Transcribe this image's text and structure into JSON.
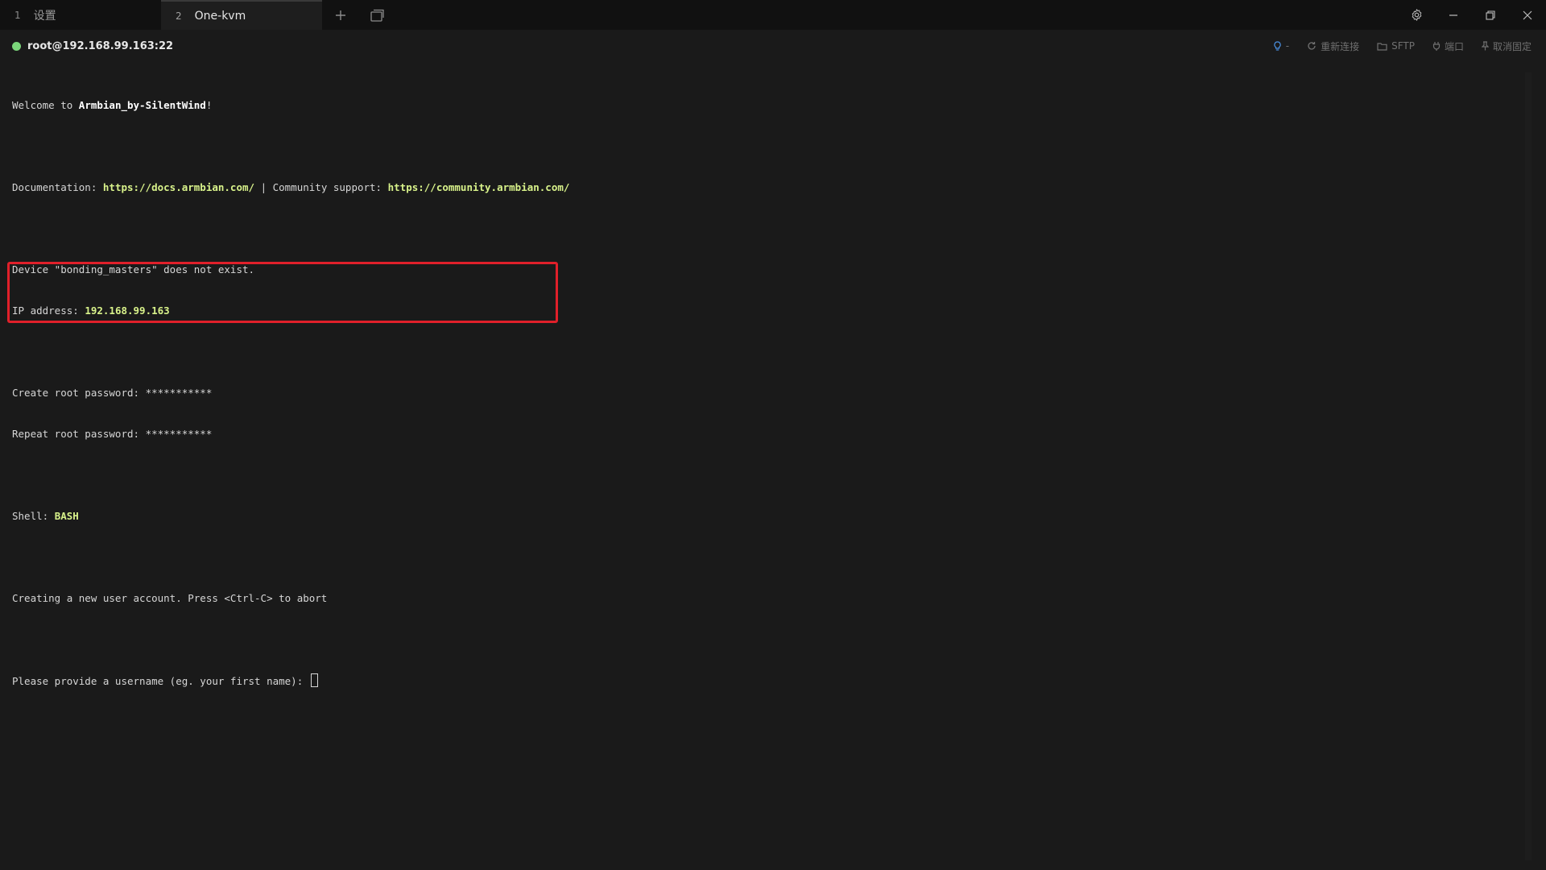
{
  "tabs": [
    {
      "num": "1",
      "label": "设置"
    },
    {
      "num": "2",
      "label": "One-kvm"
    }
  ],
  "session": {
    "host": "root@192.168.99.163:22",
    "status_color": "#7bd67a",
    "actions": {
      "hint": "-",
      "reconnect": "重新连接",
      "sftp": "SFTP",
      "port": "端口",
      "unpin": "取消固定"
    }
  },
  "terminal": {
    "welcome_prefix": "Welcome to ",
    "welcome_name": "Armbian_by-SilentWind",
    "welcome_suffix": "!",
    "doc_label": "Documentation: ",
    "doc_url": "https://docs.armbian.com/",
    "sep": " | Community support: ",
    "community_url": "https://community.armbian.com/",
    "device_line": "Device \"bonding_masters\" does not exist.",
    "ip_label": "IP address: ",
    "ip_value": "192.168.99.163",
    "create_pw": "Create root password: ***********",
    "repeat_pw": "Repeat root password: ***********",
    "shell_label": "Shell: ",
    "shell_value": "BASH",
    "creating_line": "Creating a new user account. Press <Ctrl-C> to abort",
    "prompt": "Please provide a username (eg. your first name): "
  },
  "colors": {
    "highlight": "#d8f28a",
    "annotation_box": "#e0202a",
    "background": "#1a1a1a"
  }
}
